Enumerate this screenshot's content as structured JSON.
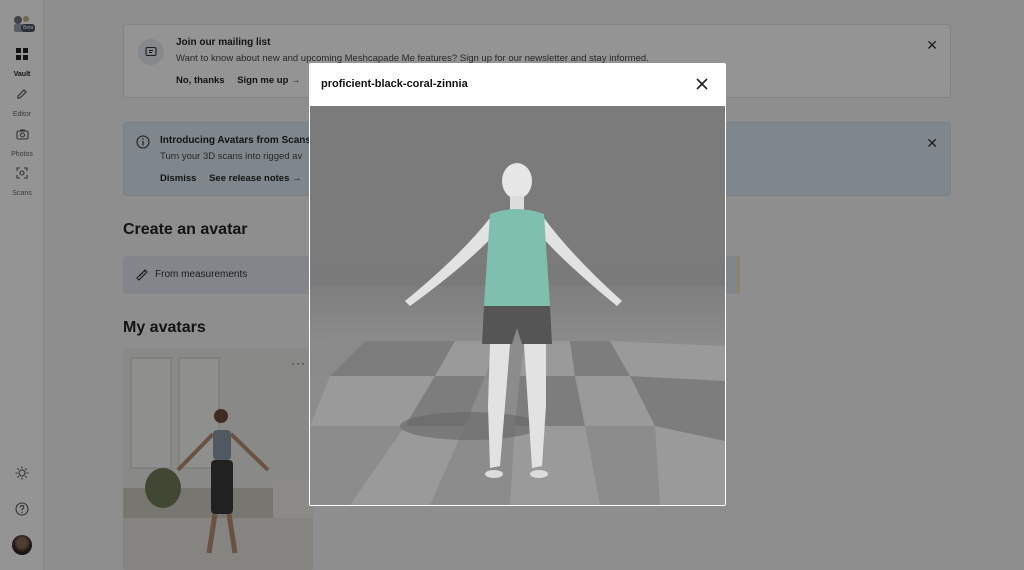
{
  "sidebar": {
    "logo_badge": "Beta",
    "items": [
      {
        "label": "Vault",
        "icon": "grid-icon",
        "active": true
      },
      {
        "label": "Editor",
        "icon": "pencil-icon",
        "active": false
      },
      {
        "label": "Photos",
        "icon": "camera-icon",
        "active": false
      },
      {
        "label": "Scans",
        "icon": "scan-icon",
        "active": false
      }
    ]
  },
  "mailing_banner": {
    "title": "Join our mailing list",
    "description": "Want to know about new and upcoming Meshcapade Me features? Sign up for our newsletter and stay informed.",
    "dismiss_label": "No, thanks",
    "signup_label": "Sign me up →"
  },
  "scans_banner": {
    "title": "Introducing Avatars from Scans",
    "description": "Turn your 3D scans into rigged av",
    "dismiss_label": "Dismiss",
    "release_label": "See release notes →"
  },
  "create_section": {
    "title": "Create an avatar",
    "from_measurements_label": "From measurements"
  },
  "avatars_section": {
    "title": "My avatars",
    "more_label": "···"
  },
  "modal": {
    "title": "proficient-black-coral-zinnia",
    "close_label": "×"
  },
  "colors": {
    "overlay": "#000000",
    "viewer_bg": "#777777",
    "tank_top": "#7fbfad",
    "shorts": "#555555"
  }
}
